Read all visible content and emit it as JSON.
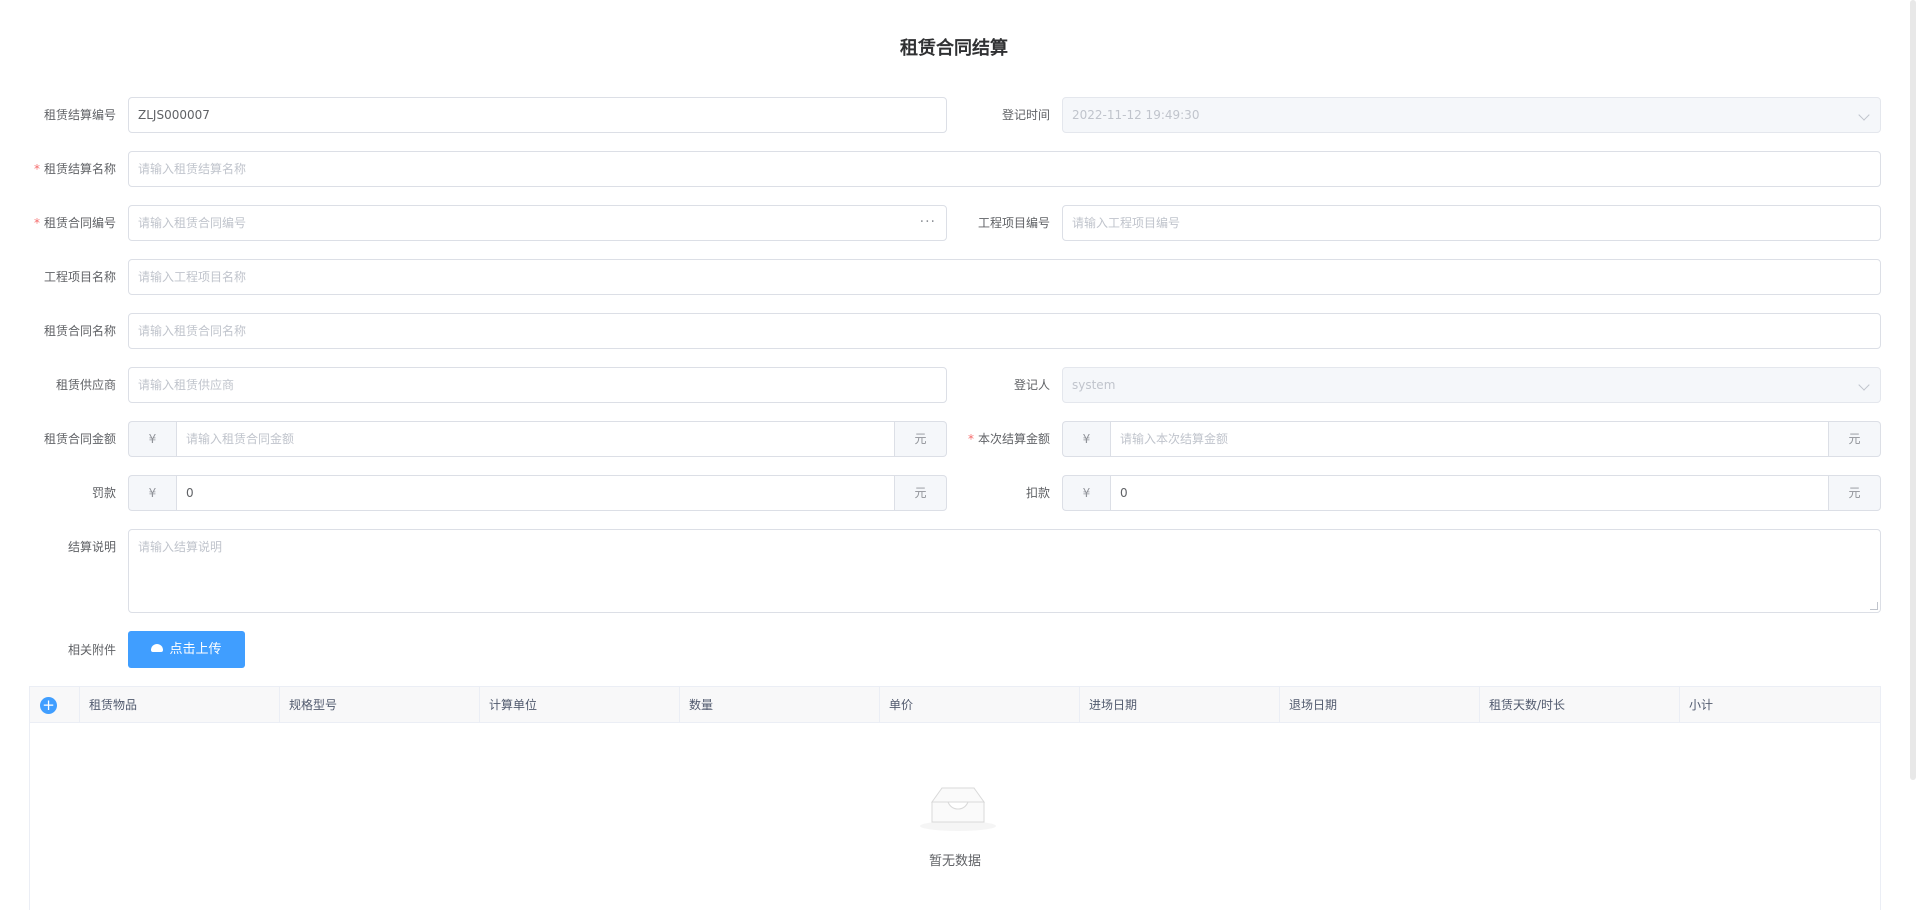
{
  "title": "租赁合同结算",
  "form": {
    "settlement_no": {
      "label": "租赁结算编号",
      "value": "ZLJS000007"
    },
    "register_time": {
      "label": "登记时间",
      "value": "2022-11-12 19:49:30"
    },
    "settlement_name": {
      "label": "租赁结算名称",
      "placeholder": "请输入租赁结算名称"
    },
    "contract_no": {
      "label": "租赁合同编号",
      "placeholder": "请输入租赁合同编号",
      "suffix": "···"
    },
    "project_no": {
      "label": "工程项目编号",
      "placeholder": "请输入工程项目编号"
    },
    "project_name": {
      "label": "工程项目名称",
      "placeholder": "请输入工程项目名称"
    },
    "contract_name": {
      "label": "租赁合同名称",
      "placeholder": "请输入租赁合同名称"
    },
    "supplier": {
      "label": "租赁供应商",
      "placeholder": "请输入租赁供应商"
    },
    "registrant": {
      "label": "登记人",
      "value": "system"
    },
    "contract_amount": {
      "label": "租赁合同金额",
      "prefix": "¥",
      "placeholder": "请输入租赁合同金额",
      "suffix": "元"
    },
    "settle_amount": {
      "label": "本次结算金额",
      "prefix": "¥",
      "placeholder": "请输入本次结算金额",
      "suffix": "元"
    },
    "penalty": {
      "label": "罚款",
      "prefix": "¥",
      "value": "0",
      "suffix": "元"
    },
    "deduction": {
      "label": "扣款",
      "prefix": "¥",
      "value": "0",
      "suffix": "元"
    },
    "remark": {
      "label": "结算说明",
      "placeholder": "请输入结算说明"
    },
    "attachment": {
      "label": "相关附件",
      "button": "点击上传"
    }
  },
  "table": {
    "add": "+",
    "columns": [
      "租赁物品",
      "规格型号",
      "计算单位",
      "数量",
      "单价",
      "进场日期",
      "退场日期",
      "租赁天数/时长",
      "小计"
    ],
    "empty_text": "暂无数据"
  },
  "colors": {
    "primary": "#409eff",
    "required": "#f56c6c"
  }
}
